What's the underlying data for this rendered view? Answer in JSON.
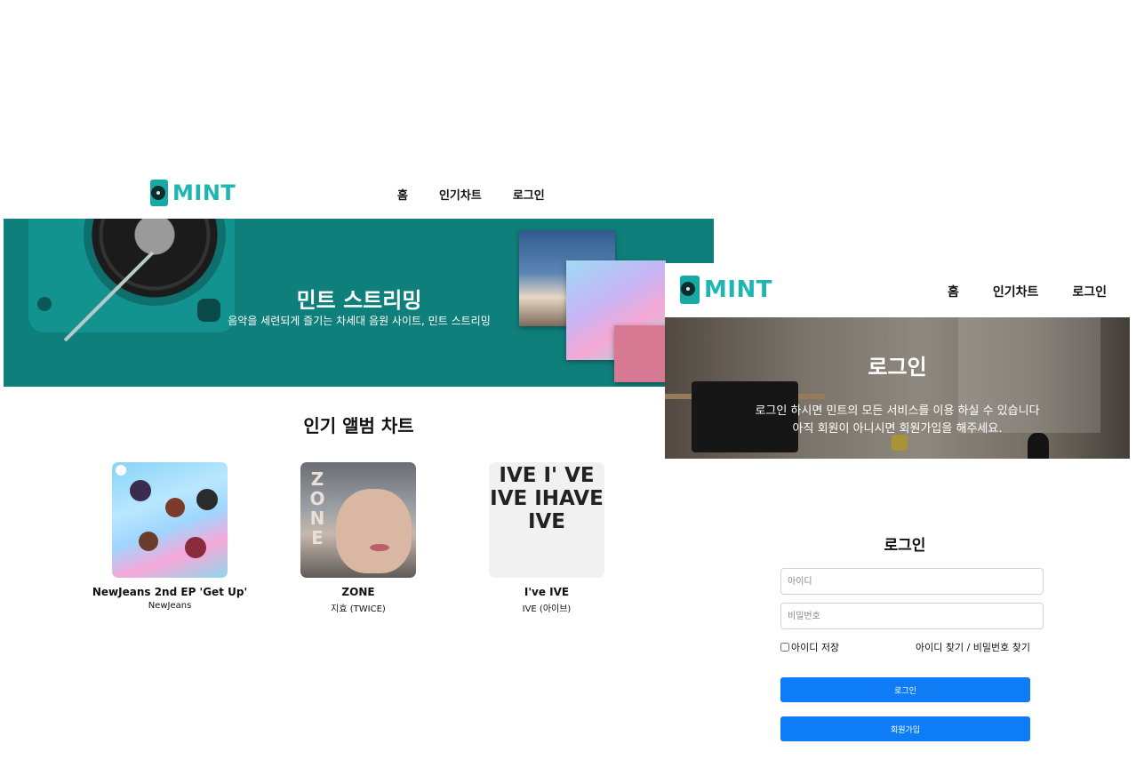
{
  "home": {
    "nav": {
      "logo_text": "MINT",
      "menu": [
        "홈",
        "인기차트",
        "로그인"
      ]
    },
    "hero": {
      "title": "민트 스트리밍",
      "subtitle": "음악을 세련되게 즐기는 차세대 음원 사이트, 민트 스트리밍",
      "accent_color": "#0f7f7b"
    },
    "chart": {
      "title": "인기 앨범 차트",
      "albums": [
        {
          "title": "NewJeans 2nd EP 'Get Up'",
          "artist": "NewJeans"
        },
        {
          "title": "ZONE",
          "artist": "지효 (TWICE)",
          "cover_text": "ZONE"
        },
        {
          "title": "I've IVE",
          "artist": "IVE (아이브)",
          "cover_text": "IVE I' VE IVE IHAVE IVE"
        }
      ]
    }
  },
  "login": {
    "nav": {
      "logo_text": "MINT",
      "menu": [
        "홈",
        "인기차트",
        "로그인"
      ]
    },
    "banner": {
      "title": "로그인",
      "line1": "로그인 하시면 민트의 모든 서비스를 이용 하실 수 있습니다",
      "line2": "아직 회원이 아니시면 회원가입을 해주세요."
    },
    "form": {
      "title": "로그인",
      "id_placeholder": "아이디",
      "pw_placeholder": "비밀번호",
      "remember_label": "아이디 저장",
      "find_links": "아이디 찾기 / 비밀번호 찾기",
      "login_button": "로그인",
      "signup_button": "회원가입",
      "button_color": "#0d7cf5"
    }
  },
  "brand_color": "#1fb6b2"
}
